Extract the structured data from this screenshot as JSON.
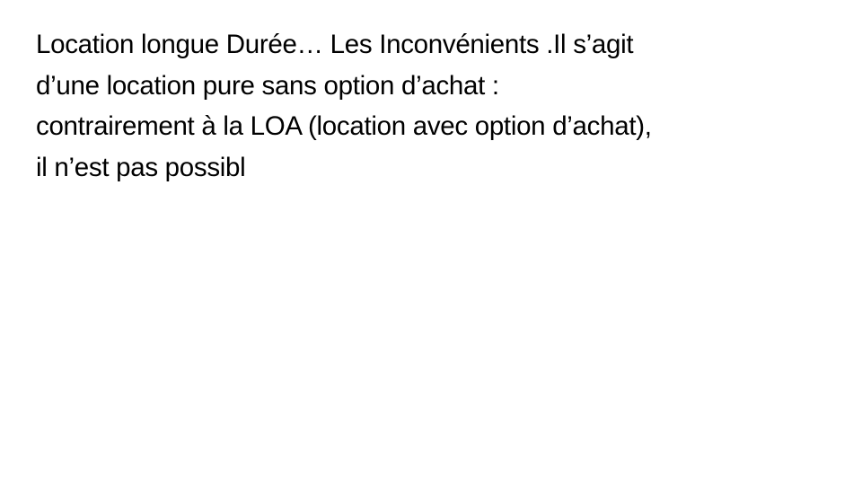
{
  "slide": {
    "lines": [
      "Location longue Durée… Les Inconvénients .Il s’agit",
      "d’une location pure sans option d’achat :",
      "contrairement à la LOA (location avec option d’achat),",
      "il n’est pas possibl"
    ]
  }
}
